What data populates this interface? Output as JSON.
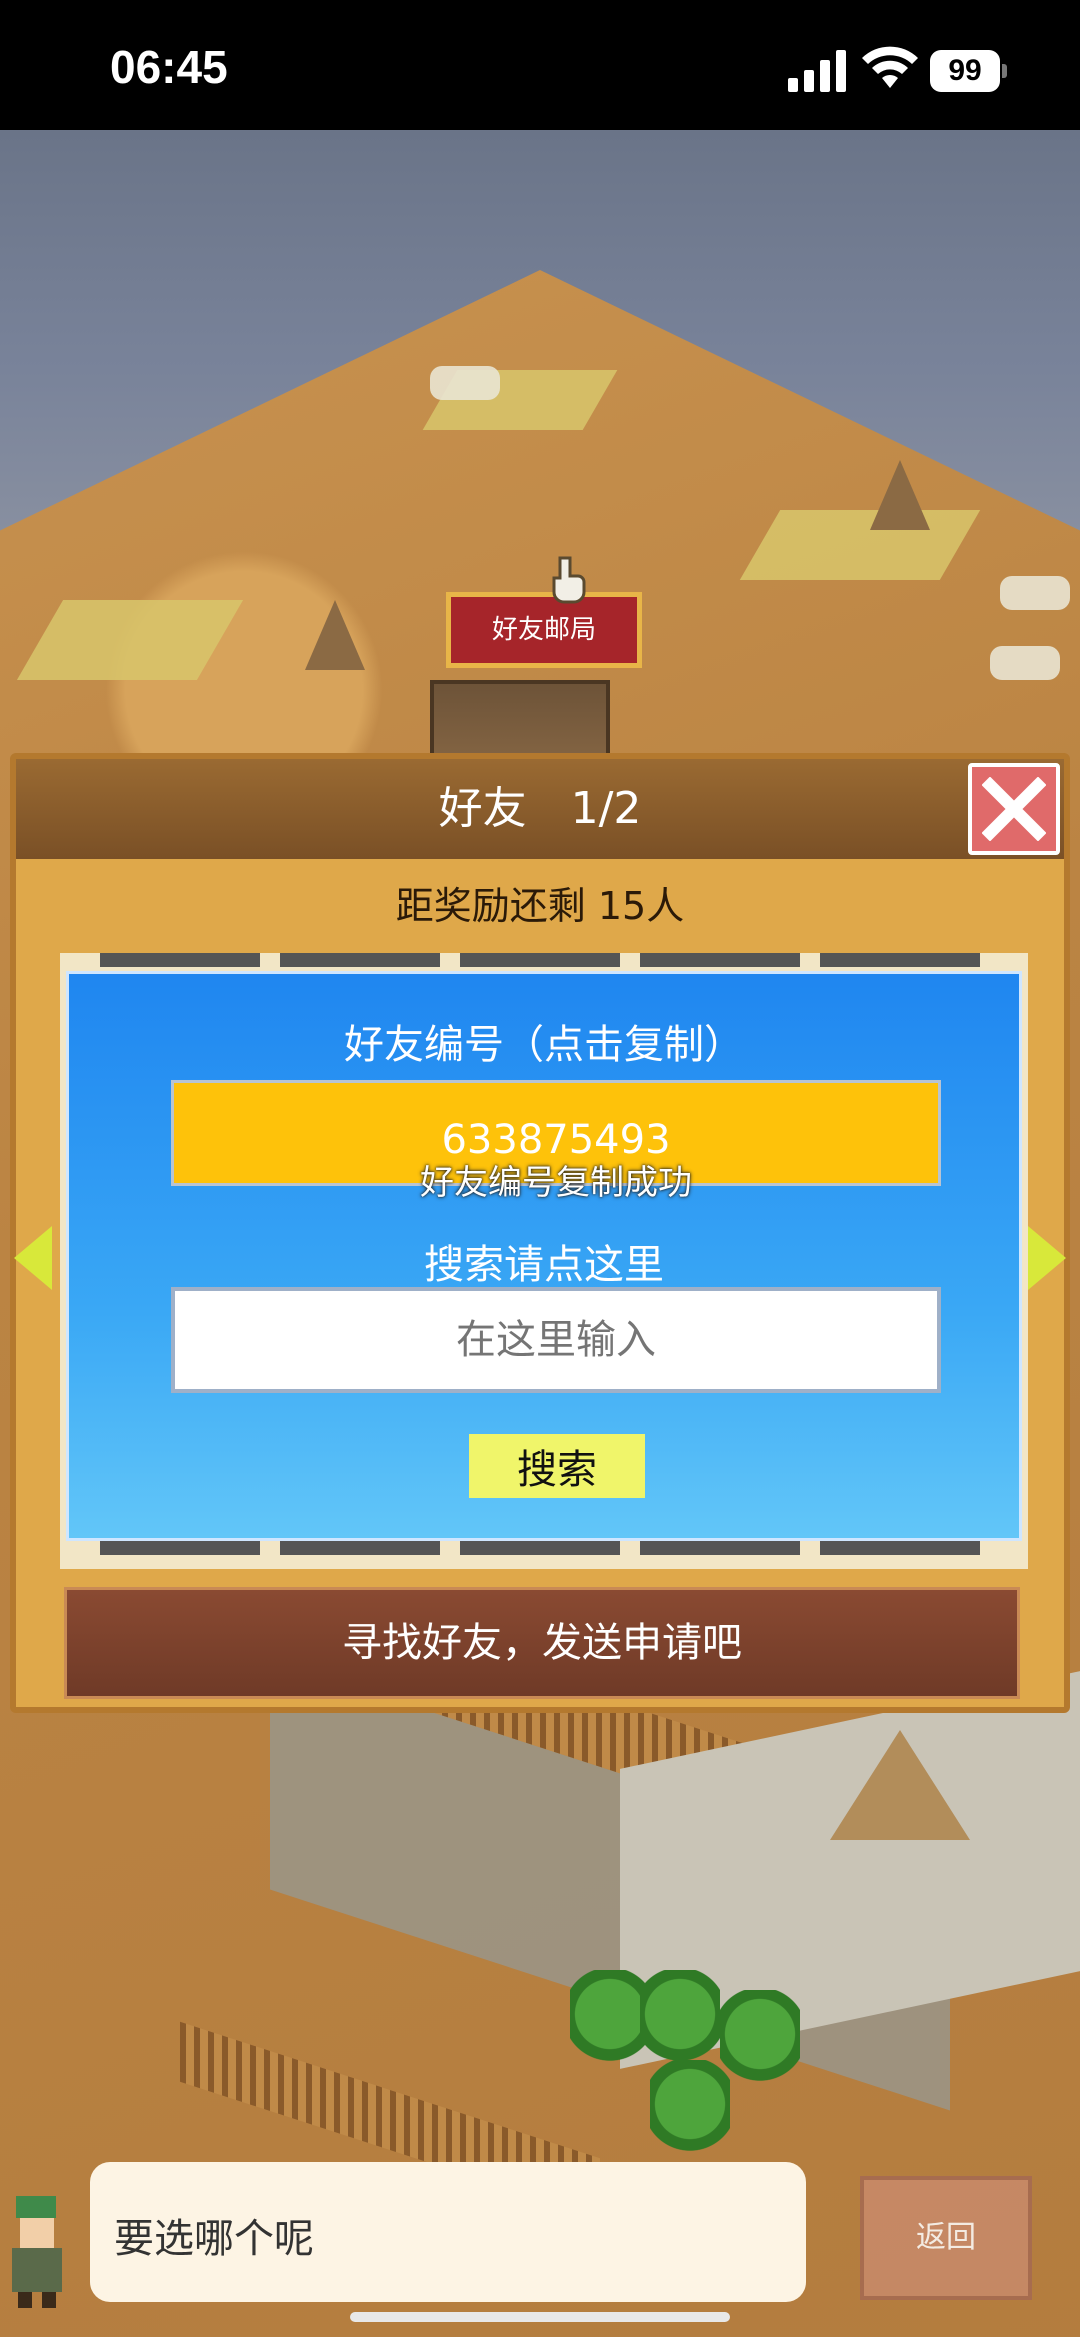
{
  "status_bar": {
    "time": "06:45",
    "battery": "99"
  },
  "map": {
    "building_label": "好友邮局"
  },
  "dialog": {
    "title": "好友　1/2",
    "reward_text": "距奖励还剩 15人",
    "card": {
      "title": "好友编号（点击复制）",
      "friend_id": "633875493",
      "copy_toast": "好友编号复制成功",
      "search_hint": "搜索请点这里",
      "search_placeholder": "在这里输入",
      "search_button": "搜索"
    },
    "find_button": "寻找好友，发送申请吧"
  },
  "bottom": {
    "prompt": "要选哪个呢",
    "back_button": "返回"
  },
  "colors": {
    "accent_yellow": "#fec20a",
    "card_blue": "#1f86f0",
    "close_red": "#e06a6a"
  }
}
